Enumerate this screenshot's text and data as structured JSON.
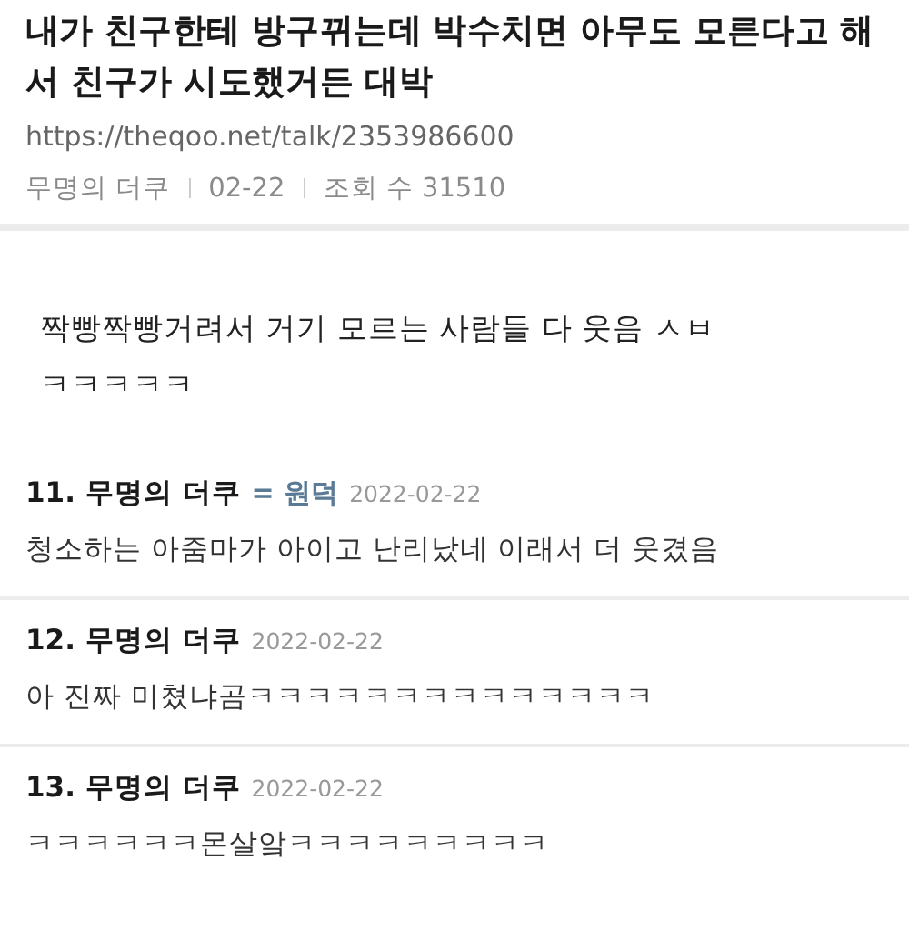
{
  "post": {
    "title": "내가 친구한테 방구뀌는데 박수치면 아무도 모른다고 해서 친구가 시도했거든 대박",
    "url": "https://theqoo.net/talk/2353986600",
    "author": "무명의 더쿠",
    "date": "02-22",
    "views": "조회 수 31510",
    "body": "짝빵짝빵거려서 거기 모르는 사람들 다 웃음 ㅅㅂㅋㅋㅋㅋㅋ"
  },
  "comments": [
    {
      "number": "11.",
      "author": "무명의 더쿠",
      "reply_to": "= 원덕",
      "date": "2022-02-22",
      "text": "청소하는 아줌마가 아이고 난리났네 이래서 더 웃겼음"
    },
    {
      "number": "12.",
      "author": "무명의 더쿠",
      "date": "2022-02-22",
      "text": "아 진짜 미쳤냐곰ㅋㅋㅋㅋㅋㅋㅋㅋㅋㅋㅋㅋㅋㅋ"
    },
    {
      "number": "13.",
      "author": "무명의 더쿠",
      "date": "2022-02-22",
      "text": "ㅋㅋㅋㅋㅋㅋ몬살앜ㅋㅋㅋㅋㅋㅋㅋㅋㅋ"
    }
  ]
}
